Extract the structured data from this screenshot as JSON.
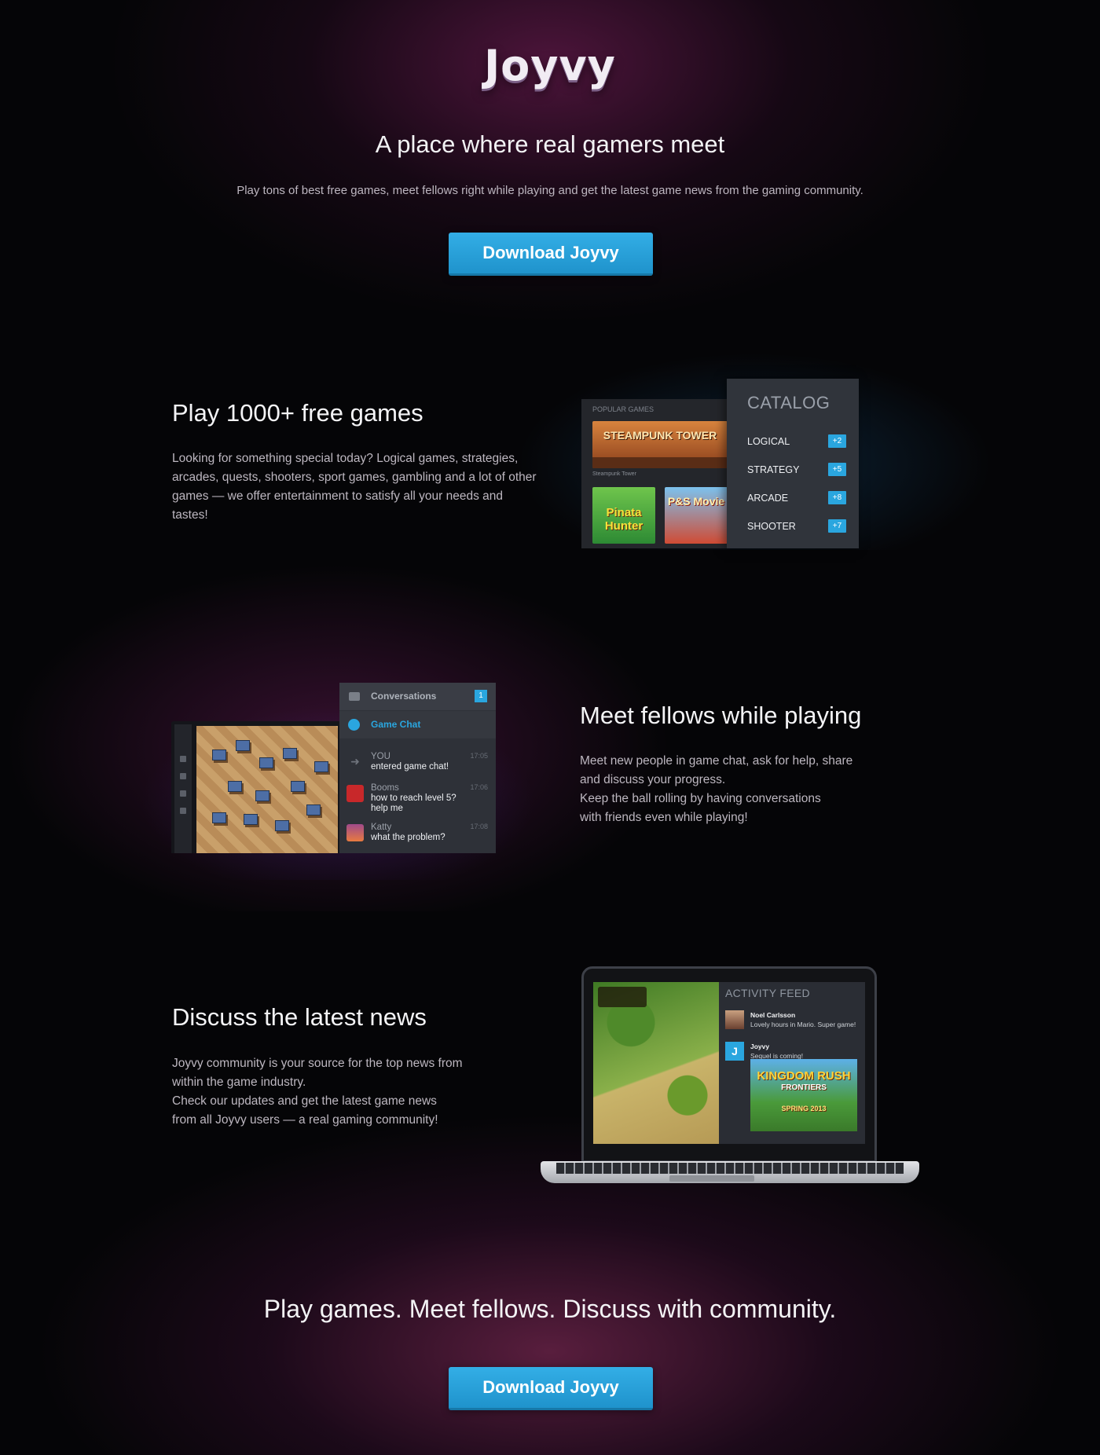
{
  "brand": {
    "logo": "Joyvy"
  },
  "hero": {
    "title": "A place where real gamers meet",
    "subtitle": "Play tons of best free games, meet fellows right while playing and get the latest game news from the gaming community.",
    "cta": "Download Joyvy"
  },
  "section_games": {
    "title": "Play 1000+ free games",
    "body": "Looking for something special today? Logical games, strategies, arcades, quests, shooters, sport games, gambling and a lot of other games — we offer entertainment to satisfy all your needs and tastes!",
    "mockup": {
      "popular_label": "POPULAR GAMES",
      "tiles": [
        "STEAMPUNK TOWER",
        "Pinata Hunter",
        "P&S Movie"
      ],
      "steampunk_caption": "Steampunk Tower",
      "catalog_title": "CATALOG",
      "categories": [
        {
          "label": "LOGICAL",
          "badge": "+2"
        },
        {
          "label": "STRATEGY",
          "badge": "+5"
        },
        {
          "label": "ARCADE",
          "badge": "+8"
        },
        {
          "label": "SHOOTER",
          "badge": "+7"
        }
      ]
    }
  },
  "section_chat": {
    "title": "Meet fellows while playing",
    "body_lines": [
      "Meet new people in game chat, ask for help, share",
      "and discuss your progress.",
      "Keep the ball rolling by having conversations",
      "with friends even while playing!"
    ],
    "mockup": {
      "conversations_label": "Conversations",
      "conversations_count": "1",
      "game_chat_label": "Game Chat",
      "messages": [
        {
          "name": "YOU",
          "time": "17:05",
          "text": "entered game chat!"
        },
        {
          "name": "Booms",
          "time": "17:06",
          "text": "how to reach level 5? help me"
        },
        {
          "name": "Katty",
          "time": "17:08",
          "text": "what the problem?"
        }
      ]
    }
  },
  "section_news": {
    "title": "Discuss the latest news",
    "body_lines": [
      "Joyvy community is your source for the top news from",
      "within the game industry.",
      "Check our updates and get the latest game news",
      "from all Joyvy users — a real gaming community!"
    ],
    "mockup": {
      "feed_title": "ACTIVITY FEED",
      "posts": [
        {
          "name": "Noel Carlsson",
          "text": "Lovely hours in Mario. Super game!"
        },
        {
          "name": "Joyvy",
          "text": "Sequel is coming!"
        }
      ],
      "promo_title": "KINGDOM RUSH",
      "promo_sub": "FRONTIERS",
      "promo_date": "SPRING 2013"
    }
  },
  "footer": {
    "tagline": "Play games. Meet fellows. Discuss with community.",
    "cta": "Download Joyvy"
  }
}
